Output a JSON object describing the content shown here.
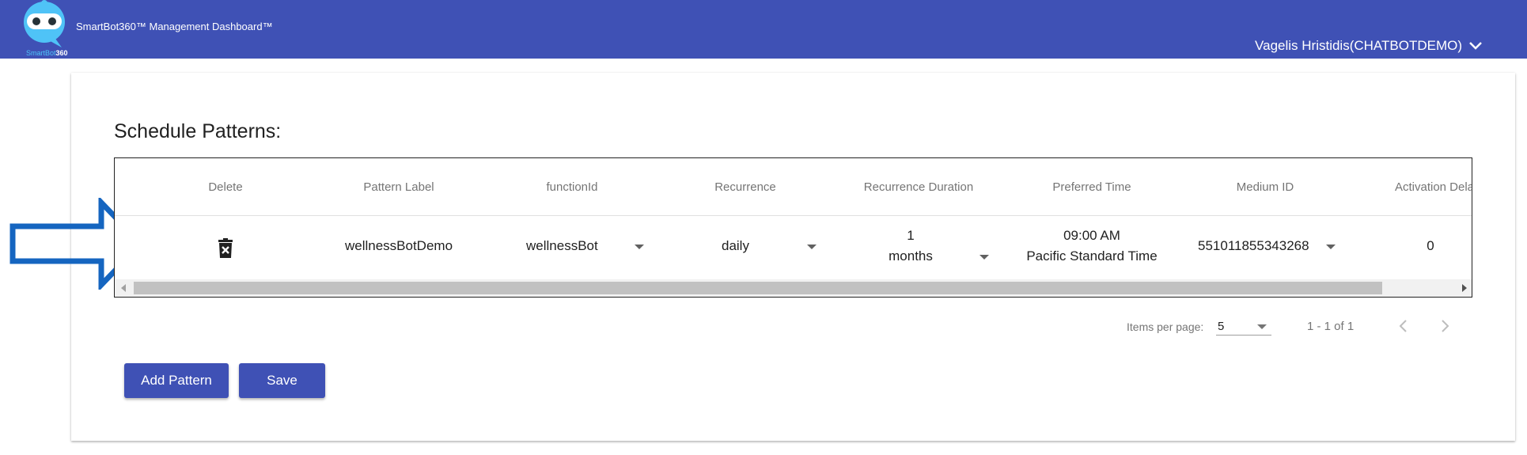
{
  "app": {
    "title": "SmartBot360™ Management Dashboard™",
    "logo_text_a": "SmartBot",
    "logo_text_b": "360",
    "user": "Vagelis Hristidis(CHATBOTDEMO)"
  },
  "colors": {
    "primary": "#3f51b5",
    "arrow": "#1565c0",
    "logo": "#4fc3f7"
  },
  "section": {
    "title": "Schedule Patterns:"
  },
  "table": {
    "headers": [
      "Delete",
      "Pattern Label",
      "functionId",
      "Recurrence",
      "Recurrence Duration",
      "Preferred Time",
      "Medium ID",
      "Activation Dela"
    ],
    "row": {
      "pattern_label": "wellnessBotDemo",
      "function_id": "wellnessBot",
      "recurrence": "daily",
      "duration_value": "1",
      "duration_unit": "months",
      "time": "09:00 AM",
      "timezone": "Pacific Standard Time",
      "medium_id": "551011855343268",
      "activation_delay": "0"
    }
  },
  "paginator": {
    "items_per_page_label": "Items per page:",
    "page_size": "5",
    "range": "1 - 1 of 1"
  },
  "buttons": {
    "add_pattern": "Add Pattern",
    "save": "Save"
  },
  "icons": {
    "delete": "delete-forever-icon",
    "user_menu": "chevron-down-icon",
    "prev": "chevron-left-icon",
    "next": "chevron-right-icon",
    "pointer": "arrow-right-outline-icon"
  }
}
